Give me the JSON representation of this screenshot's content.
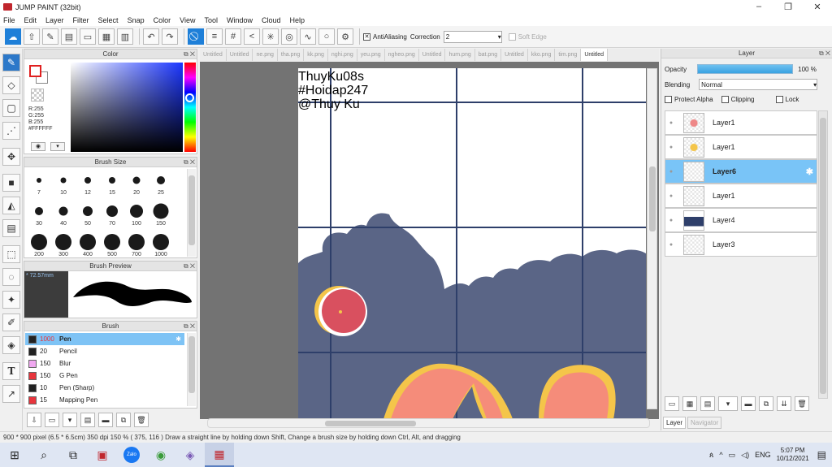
{
  "window": {
    "title": "JUMP PAINT (32bit)",
    "minimize": "–",
    "maximize": "❐",
    "close": "✕"
  },
  "menu": [
    "File",
    "Edit",
    "Layer",
    "Filter",
    "Select",
    "Snap",
    "Color",
    "View",
    "Tool",
    "Window",
    "Cloud",
    "Help"
  ],
  "toolbar": {
    "antialiasing_label": "AntiAliasing",
    "correction_label": "Correction",
    "correction_value": "2",
    "soft_edge_label": "Soft Edge"
  },
  "color_panel": {
    "title": "Color",
    "r": "R:255",
    "g": "G:255",
    "b": "B:255",
    "hex": "#FFFFFF",
    "foreground": "#ffffff",
    "background": "#ffffff"
  },
  "brush_size_panel": {
    "title": "Brush Size",
    "sizes": [
      "7",
      "10",
      "12",
      "15",
      "20",
      "25",
      "30",
      "40",
      "50",
      "70",
      "100",
      "150",
      "200",
      "300",
      "400",
      "500",
      "700",
      "1000"
    ]
  },
  "brush_preview_panel": {
    "title": "Brush Preview",
    "size_readout": "* 72.57mm"
  },
  "brush_panel": {
    "title": "Brush",
    "brushes": [
      {
        "size": "1000",
        "name": "Pen",
        "color": "#222222",
        "selected": true
      },
      {
        "size": "20",
        "name": "Pencil",
        "color": "#222222",
        "selected": false
      },
      {
        "size": "150",
        "name": "Blur",
        "color": "#f0a8f0",
        "selected": false
      },
      {
        "size": "150",
        "name": "G Pen",
        "color": "#e8353d",
        "selected": false
      },
      {
        "size": "10",
        "name": "Pen (Sharp)",
        "color": "#222222",
        "selected": false
      },
      {
        "size": "15",
        "name": "Mapping Pen",
        "color": "#e8353d",
        "selected": false
      }
    ]
  },
  "canvas_tabs": [
    "Untitled",
    "Untitled",
    "ne.png",
    "tha.png",
    "kk.png",
    "nghi.png",
    "yeu.png",
    "ngheo.png",
    "Untitled",
    "hum.png",
    "bat.png",
    "Untitled",
    "kko.png",
    "tim.png",
    "Untitled"
  ],
  "canvas": {
    "watermark": [
      "ThuyKu08s",
      "#Hoidap247",
      "@Thuy Ku"
    ],
    "colors": {
      "sky": "#ffffff",
      "blob": "#5a6586",
      "grid": "#2e3f6a",
      "pink": "#f58c7a",
      "yellow": "#f4c54a",
      "red_circle": "#d9505f"
    }
  },
  "layer_panel": {
    "title": "Layer",
    "opacity_label": "Opacity",
    "opacity_value": "100 %",
    "blending_label": "Blending",
    "blending_value": "Normal",
    "protect_alpha_label": "Protect Alpha",
    "clipping_label": "Clipping",
    "lock_label": "Lock",
    "layers": [
      {
        "name": "Layer1",
        "selected": false
      },
      {
        "name": "Layer1",
        "selected": false
      },
      {
        "name": "Layer6",
        "selected": true
      },
      {
        "name": "Layer1",
        "selected": false
      },
      {
        "name": "Layer4",
        "selected": false
      },
      {
        "name": "Layer3",
        "selected": false
      }
    ],
    "tabs": [
      "Layer",
      "Navigator"
    ]
  },
  "statusbar": {
    "text": "900 * 900 pixel   (6.5 * 6.5cm)   350 dpi   150 %   ( 375, 116 )   Draw a straight line by holding down Shift, Change a brush size by holding down Ctrl, Alt, and dragging"
  },
  "taskbar": {
    "language": "ENG",
    "time": "5:07 PM",
    "date": "10/12/2021",
    "zalo_label": "Zalo"
  }
}
